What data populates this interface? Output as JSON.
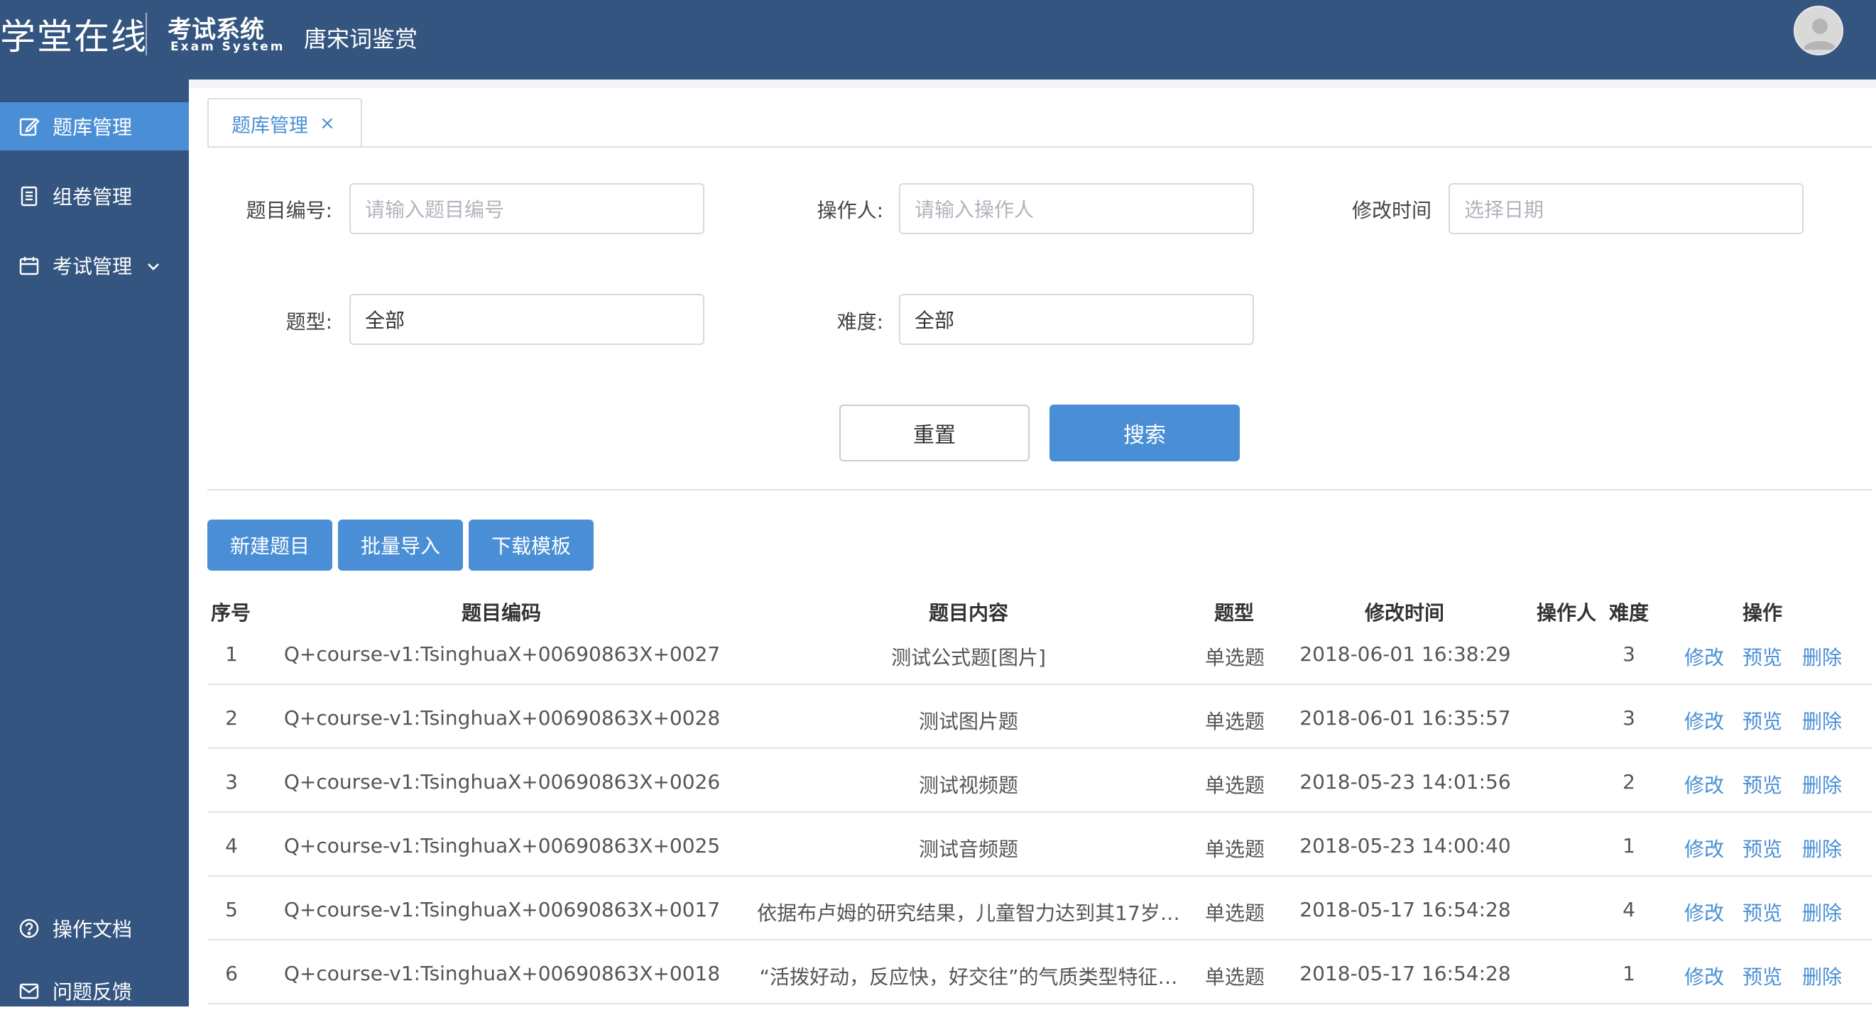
{
  "header": {
    "logo": "学堂在线",
    "exam_title": "考试系统",
    "exam_subtitle": "Exam System",
    "course_title": "唐宋词鉴赏",
    "avatar_icon": "user-avatar-icon"
  },
  "sidebar": {
    "items": [
      {
        "label": "题库管理",
        "icon": "edit-icon",
        "active": true
      },
      {
        "label": "组卷管理",
        "icon": "document-list-icon"
      },
      {
        "label": "考试管理",
        "icon": "calendar-icon",
        "expandable": true
      }
    ],
    "bottom_items": [
      {
        "label": "操作文档",
        "icon": "help-circle-icon"
      },
      {
        "label": "问题反馈",
        "icon": "mail-icon"
      }
    ]
  },
  "tab": {
    "label": "题库管理",
    "close": "×"
  },
  "filters": {
    "question_id": {
      "label": "题目编号:",
      "placeholder": "请输入题目编号"
    },
    "operator": {
      "label": "操作人:",
      "placeholder": "请输入操作人"
    },
    "modified_time": {
      "label": "修改时间",
      "placeholder": "选择日期"
    },
    "question_type": {
      "label": "题型:",
      "value": "全部"
    },
    "difficulty": {
      "label": "难度:",
      "value": "全部"
    }
  },
  "actions": {
    "reset": "重置",
    "search": "搜索"
  },
  "toolbar": {
    "new": "新建题目",
    "import": "批量导入",
    "template": "下载模板"
  },
  "table": {
    "headers": [
      "序号",
      "题目编码",
      "题目内容",
      "题型",
      "修改时间",
      "操作人",
      "难度",
      "操作"
    ],
    "row_actions": [
      "修改",
      "预览",
      "删除"
    ],
    "rows": [
      {
        "no": "1",
        "code": "Q+course-v1:TsinghuaX+00690863X+0027",
        "content": "测试公式题[图片]",
        "type": "单选题",
        "time": "2018-06-01 16:38:29",
        "operator": "",
        "difficulty": "3"
      },
      {
        "no": "2",
        "code": "Q+course-v1:TsinghuaX+00690863X+0028",
        "content": "测试图片题",
        "type": "单选题",
        "time": "2018-06-01 16:35:57",
        "operator": "",
        "difficulty": "3"
      },
      {
        "no": "3",
        "code": "Q+course-v1:TsinghuaX+00690863X+0026",
        "content": "测试视频题",
        "type": "单选题",
        "time": "2018-05-23 14:01:56",
        "operator": "",
        "difficulty": "2"
      },
      {
        "no": "4",
        "code": "Q+course-v1:TsinghuaX+00690863X+0025",
        "content": "测试音频题",
        "type": "单选题",
        "time": "2018-05-23 14:00:40",
        "operator": "",
        "difficulty": "1"
      },
      {
        "no": "5",
        "code": "Q+course-v1:TsinghuaX+00690863X+0017",
        "content": "依据布卢姆的研究结果，儿童智力达到其17岁…",
        "type": "单选题",
        "time": "2018-05-17 16:54:28",
        "operator": "",
        "difficulty": "4"
      },
      {
        "no": "6",
        "code": "Q+course-v1:TsinghuaX+00690863X+0018",
        "content": "“活拨好动，反应快，好交往”的气质类型特征…",
        "type": "单选题",
        "time": "2018-05-17 16:54:28",
        "operator": "",
        "difficulty": "1"
      }
    ]
  },
  "colors": {
    "header_bg": "#34557f",
    "accent": "#4a8fd6",
    "link": "#4a8fd6"
  }
}
